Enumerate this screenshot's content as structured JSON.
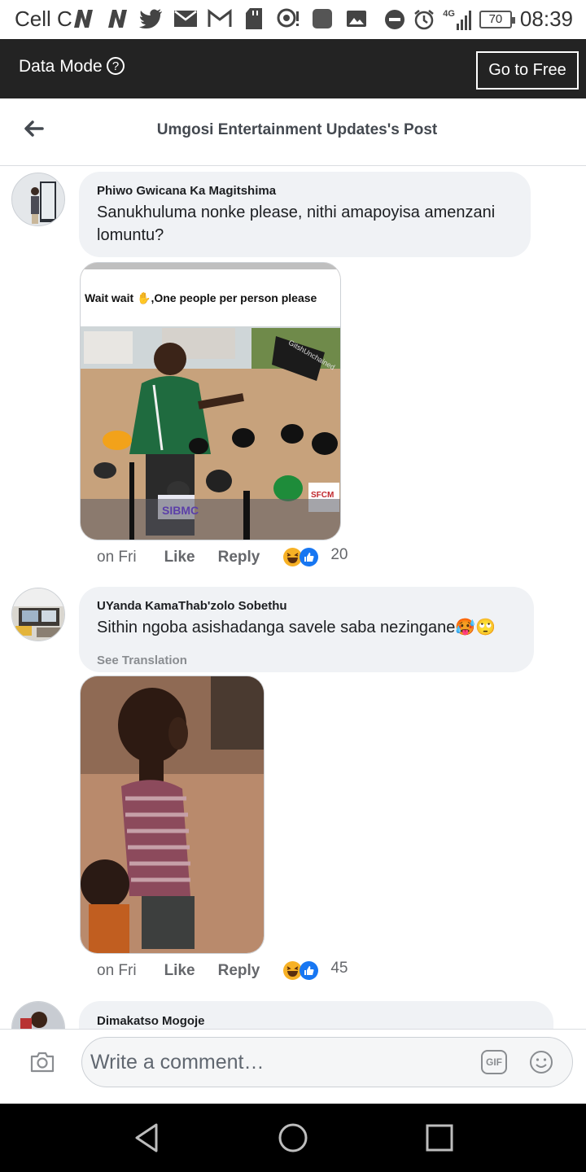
{
  "status_bar": {
    "carrier": "Cell C",
    "battery": "70",
    "network": "4G",
    "time": "08:39"
  },
  "data_bar": {
    "label": "Data Mode",
    "button": "Go to Free"
  },
  "header": {
    "title": "Umgosi Entertainment Updates's Post"
  },
  "comments": [
    {
      "author": "Phiwo Gwicana Ka Magitshima",
      "text_line1": "Sanukhuluma nonke please, nithi amapoyisa amenzani",
      "text_line2": "lomuntu?",
      "photo_caption": "Wait wait ✋,One people  per person please",
      "watermark": "GitshUnchained",
      "mic_labels": [
        "SIBMC",
        "SFCM"
      ],
      "time": "on Fri",
      "like": "Like",
      "reply": "Reply",
      "reaction_count": "20"
    },
    {
      "author": "UYanda KamaThab'zolo Sobethu",
      "text": "Sithin ngoba asishadanga savele saba nezingane🥵🙄",
      "see_translation": "See Translation",
      "time": "on Fri",
      "like": "Like",
      "reply": "Reply",
      "reaction_count": "45"
    },
    {
      "author": "Dimakatso Mogoje"
    }
  ],
  "composer": {
    "placeholder": "Write a comment…",
    "gif": "GIF"
  },
  "colors": {
    "data_bar_bg": "#232323",
    "bubble_bg": "#f0f2f5",
    "like_blue": "#1877f2",
    "haha_yellow": "#f7b125"
  }
}
